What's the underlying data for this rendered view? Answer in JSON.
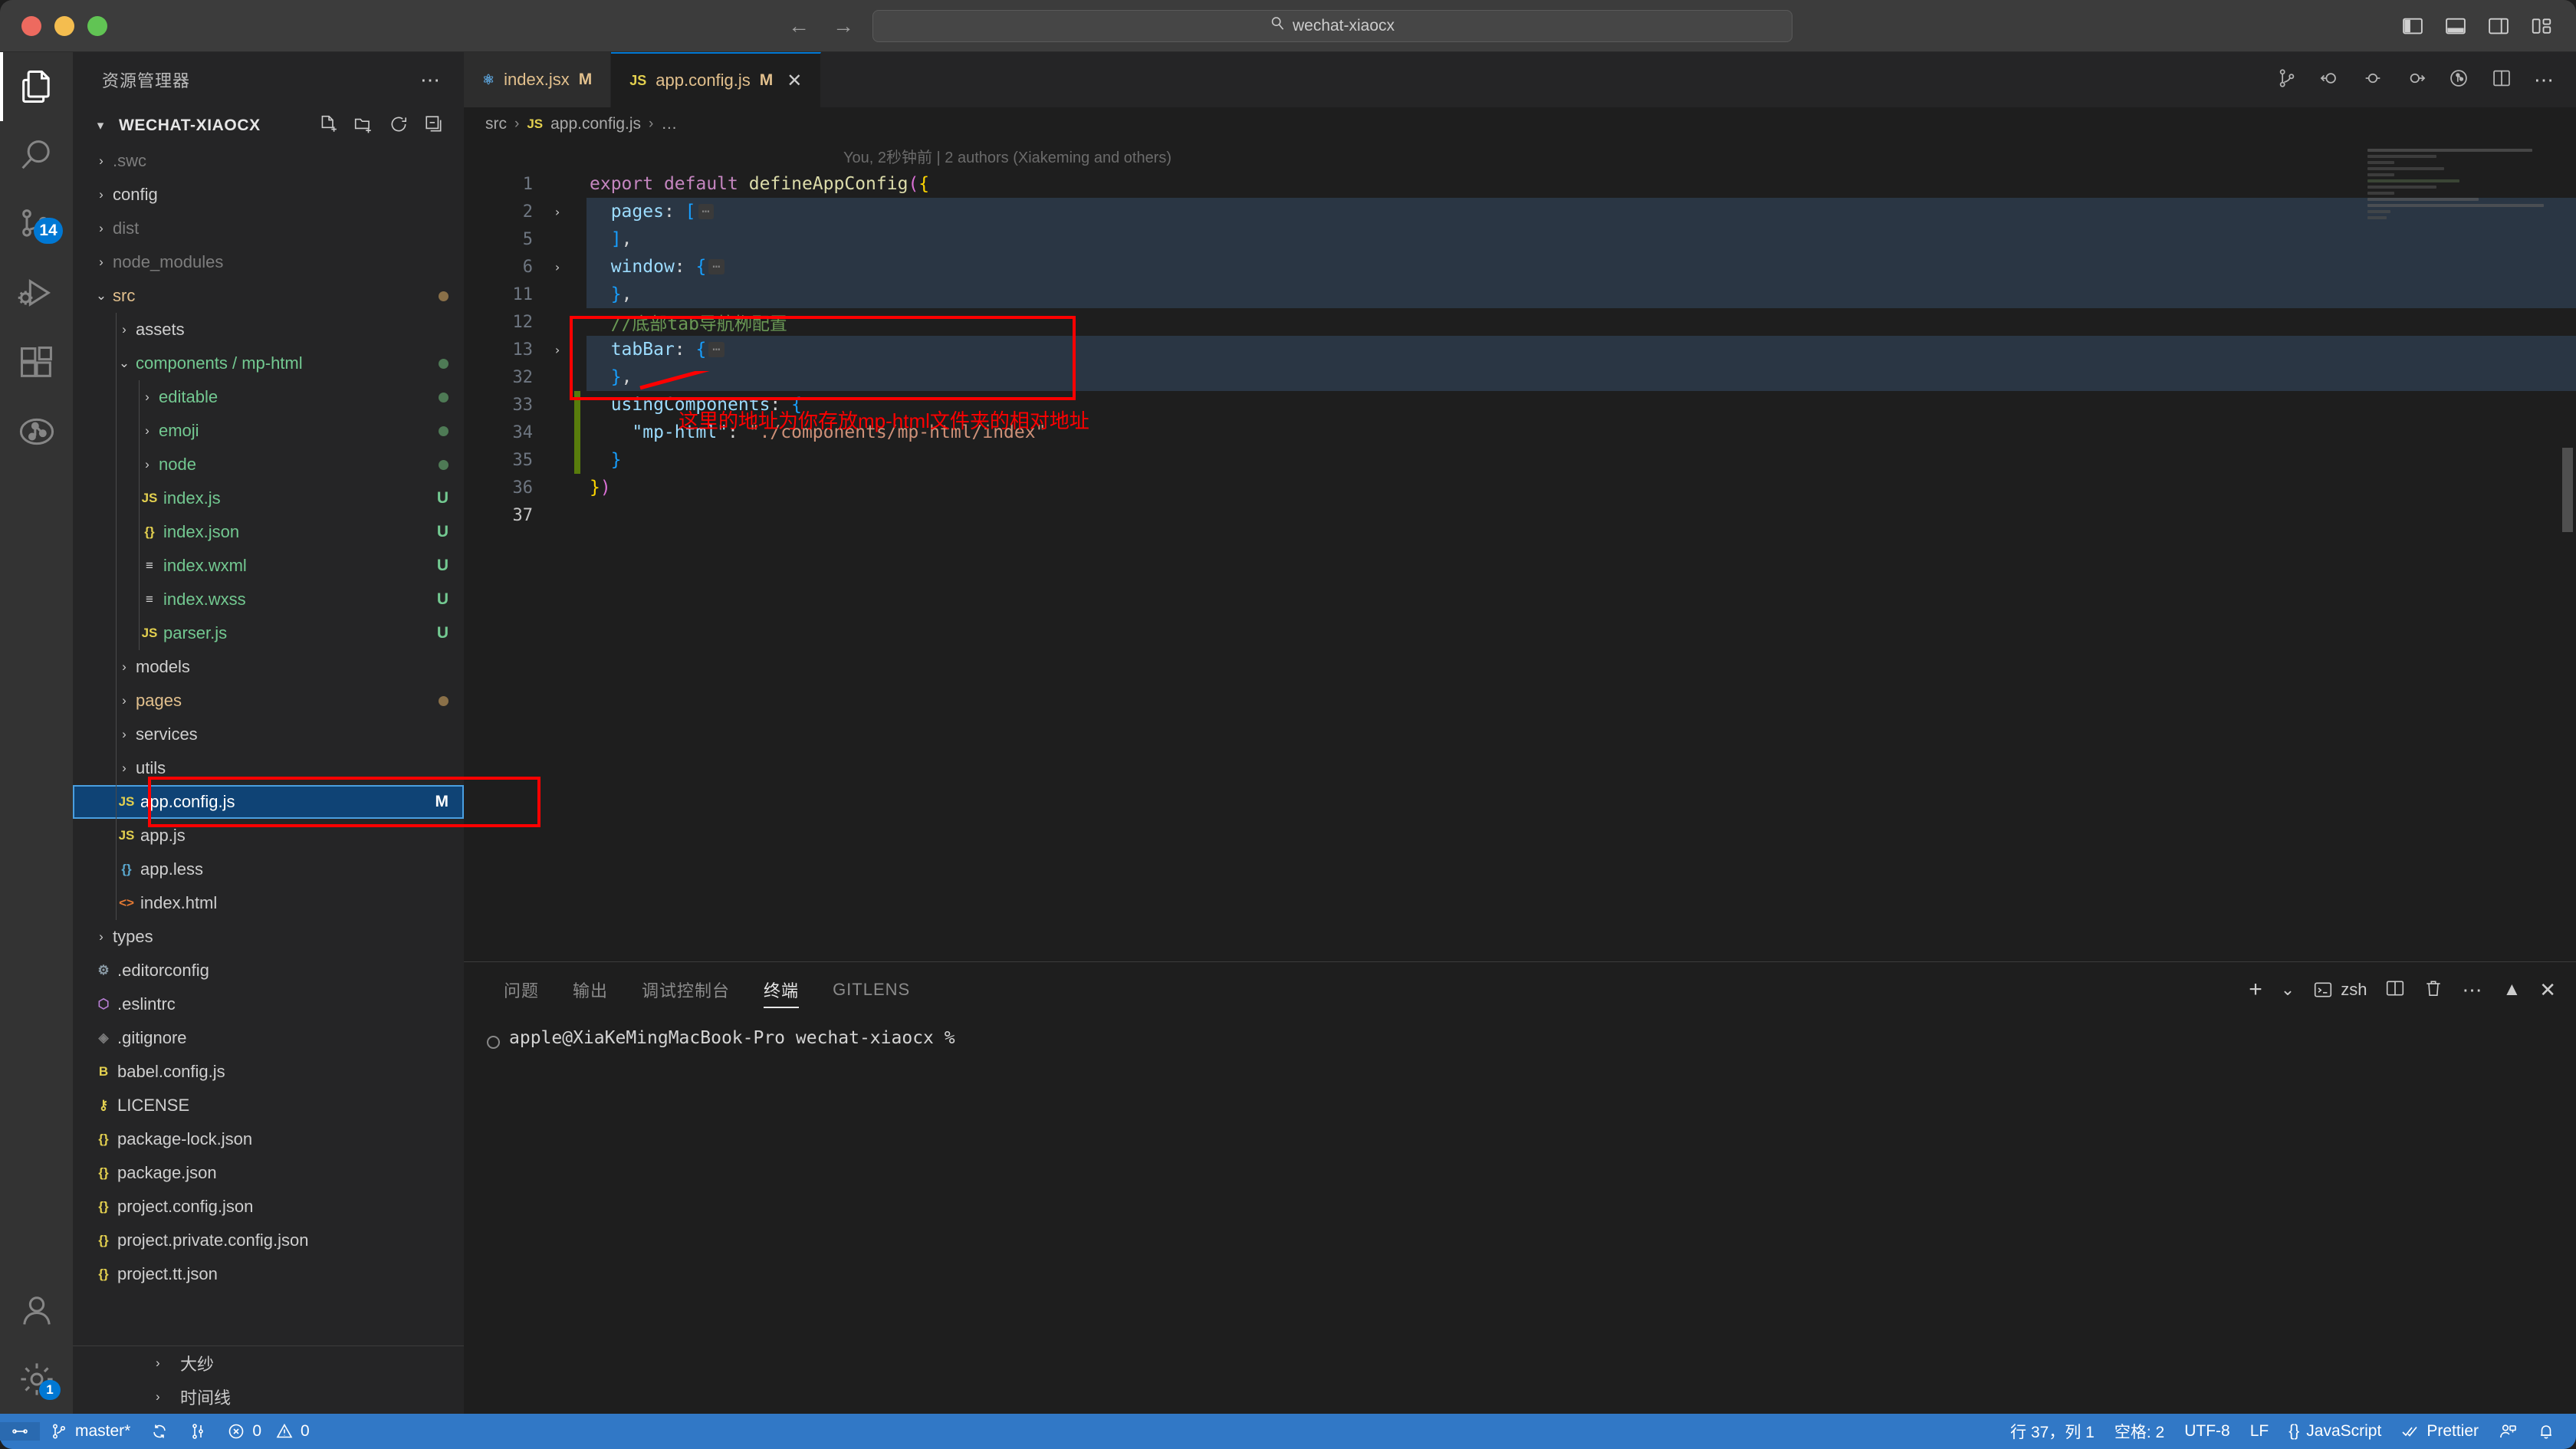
{
  "titlebar": {
    "traffic_lights": [
      "close",
      "minimize",
      "maximize"
    ],
    "back_label": "←",
    "forward_label": "→",
    "command_center": {
      "icon": "search-icon",
      "text": "wechat-xiaocx"
    },
    "layout_icons": [
      "toggle-primary-sidebar-icon",
      "toggle-panel-icon",
      "toggle-secondary-sidebar-icon",
      "customize-layout-icon"
    ]
  },
  "activitybar": {
    "items": [
      {
        "name": "explorer",
        "icon": "files-icon",
        "active": true,
        "badge": ""
      },
      {
        "name": "search",
        "icon": "search-icon",
        "active": false,
        "badge": ""
      },
      {
        "name": "source-control",
        "icon": "source-control-icon",
        "active": false,
        "badge": "14"
      },
      {
        "name": "run-and-debug",
        "icon": "debug-icon",
        "active": false,
        "badge": ""
      },
      {
        "name": "extensions",
        "icon": "extensions-icon",
        "active": false,
        "badge": ""
      },
      {
        "name": "gitlens",
        "icon": "gitlens-icon",
        "active": false,
        "badge": ""
      }
    ],
    "bottom_items": [
      {
        "name": "accounts",
        "icon": "account-icon",
        "badge": ""
      },
      {
        "name": "manage",
        "icon": "gear-icon",
        "badge": "1"
      }
    ]
  },
  "sidebar": {
    "title": "资源管理器",
    "more_label": "⋯",
    "section": {
      "name": "WECHAT-XIAOCX",
      "expanded": true,
      "actions": [
        "new-file-icon",
        "new-folder-icon",
        "refresh-icon",
        "collapse-all-icon"
      ]
    },
    "tree": [
      {
        "label": ".swc",
        "depth": 1,
        "kind": "folder",
        "expanded": false,
        "color": "dim",
        "icon": "",
        "badge": ""
      },
      {
        "label": "config",
        "depth": 1,
        "kind": "folder",
        "expanded": false,
        "color": "default",
        "icon": "",
        "badge": ""
      },
      {
        "label": "dist",
        "depth": 1,
        "kind": "folder",
        "expanded": false,
        "color": "dim",
        "icon": "",
        "badge": ""
      },
      {
        "label": "node_modules",
        "depth": 1,
        "kind": "folder",
        "expanded": false,
        "color": "dim",
        "icon": "",
        "badge": ""
      },
      {
        "label": "src",
        "depth": 1,
        "kind": "folder",
        "expanded": true,
        "color": "mod",
        "icon": "",
        "badge": "dot-mod"
      },
      {
        "label": "assets",
        "depth": 2,
        "kind": "folder",
        "expanded": false,
        "color": "default",
        "icon": "",
        "badge": ""
      },
      {
        "label": "components / mp-html",
        "depth": 2,
        "kind": "folder",
        "expanded": true,
        "color": "untrk",
        "icon": "",
        "badge": "dot-untrk"
      },
      {
        "label": "editable",
        "depth": 3,
        "kind": "folder",
        "expanded": false,
        "color": "untrk",
        "icon": "",
        "badge": "dot-untrk"
      },
      {
        "label": "emoji",
        "depth": 3,
        "kind": "folder",
        "expanded": false,
        "color": "untrk",
        "icon": "",
        "badge": "dot-untrk"
      },
      {
        "label": "node",
        "depth": 3,
        "kind": "folder",
        "expanded": false,
        "color": "untrk",
        "icon": "",
        "badge": "dot-untrk"
      },
      {
        "label": "index.js",
        "depth": 3,
        "kind": "file",
        "expanded": false,
        "color": "untrk",
        "icon": "js",
        "badge": "U"
      },
      {
        "label": "index.json",
        "depth": 3,
        "kind": "file",
        "expanded": false,
        "color": "untrk",
        "icon": "json",
        "badge": "U"
      },
      {
        "label": "index.wxml",
        "depth": 3,
        "kind": "file",
        "expanded": false,
        "color": "untrk",
        "icon": "wxml",
        "badge": "U"
      },
      {
        "label": "index.wxss",
        "depth": 3,
        "kind": "file",
        "expanded": false,
        "color": "untrk",
        "icon": "wxml",
        "badge": "U"
      },
      {
        "label": "parser.js",
        "depth": 3,
        "kind": "file",
        "expanded": false,
        "color": "untrk",
        "icon": "js",
        "badge": "U"
      },
      {
        "label": "models",
        "depth": 2,
        "kind": "folder",
        "expanded": false,
        "color": "default",
        "icon": "",
        "badge": ""
      },
      {
        "label": "pages",
        "depth": 2,
        "kind": "folder",
        "expanded": false,
        "color": "mod",
        "icon": "",
        "badge": "dot-mod"
      },
      {
        "label": "services",
        "depth": 2,
        "kind": "folder",
        "expanded": false,
        "color": "default",
        "icon": "",
        "badge": ""
      },
      {
        "label": "utils",
        "depth": 2,
        "kind": "folder",
        "expanded": false,
        "color": "default",
        "icon": "",
        "badge": ""
      },
      {
        "label": "app.config.js",
        "depth": 2,
        "kind": "file",
        "expanded": false,
        "color": "default",
        "icon": "js",
        "badge": "M",
        "selected": true
      },
      {
        "label": "app.js",
        "depth": 2,
        "kind": "file",
        "expanded": false,
        "color": "default",
        "icon": "js",
        "badge": ""
      },
      {
        "label": "app.less",
        "depth": 2,
        "kind": "file",
        "expanded": false,
        "color": "default",
        "icon": "less",
        "badge": ""
      },
      {
        "label": "index.html",
        "depth": 2,
        "kind": "file",
        "expanded": false,
        "color": "default",
        "icon": "html",
        "badge": ""
      },
      {
        "label": "types",
        "depth": 1,
        "kind": "folder",
        "expanded": false,
        "color": "default",
        "icon": "",
        "badge": ""
      },
      {
        "label": ".editorconfig",
        "depth": 1,
        "kind": "file",
        "expanded": false,
        "color": "default",
        "icon": "gear",
        "badge": ""
      },
      {
        "label": ".eslintrc",
        "depth": 1,
        "kind": "file",
        "expanded": false,
        "color": "default",
        "icon": "eslint",
        "badge": ""
      },
      {
        "label": ".gitignore",
        "depth": 1,
        "kind": "file",
        "expanded": false,
        "color": "default",
        "icon": "git",
        "badge": ""
      },
      {
        "label": "babel.config.js",
        "depth": 1,
        "kind": "file",
        "expanded": false,
        "color": "default",
        "icon": "babel",
        "badge": ""
      },
      {
        "label": "LICENSE",
        "depth": 1,
        "kind": "file",
        "expanded": false,
        "color": "default",
        "icon": "license",
        "badge": ""
      },
      {
        "label": "package-lock.json",
        "depth": 1,
        "kind": "file",
        "expanded": false,
        "color": "default",
        "icon": "json",
        "badge": ""
      },
      {
        "label": "package.json",
        "depth": 1,
        "kind": "file",
        "expanded": false,
        "color": "default",
        "icon": "json",
        "badge": ""
      },
      {
        "label": "project.config.json",
        "depth": 1,
        "kind": "file",
        "expanded": false,
        "color": "default",
        "icon": "json",
        "badge": ""
      },
      {
        "label": "project.private.config.json",
        "depth": 1,
        "kind": "file",
        "expanded": false,
        "color": "default",
        "icon": "json",
        "badge": ""
      },
      {
        "label": "project.tt.json",
        "depth": 1,
        "kind": "file",
        "expanded": false,
        "color": "default",
        "icon": "json",
        "badge": ""
      }
    ],
    "footer_sections": [
      {
        "label": "大纱"
      },
      {
        "label": "时间线"
      }
    ]
  },
  "editor": {
    "tabs": [
      {
        "label": "index.jsx",
        "icon": "react-icon",
        "dirty_badge": "M",
        "active": false,
        "closable": false
      },
      {
        "label": "app.config.js",
        "icon": "js-icon",
        "dirty_badge": "M",
        "active": true,
        "closable": true,
        "close_label": "✕"
      }
    ],
    "tab_actions": [
      "source-control-compare-icon",
      "go-to-previous-change-icon",
      "previous-change-icon",
      "next-change-icon",
      "gitlens-blame-icon",
      "split-editor-icon",
      "more-actions-icon"
    ],
    "breadcrumb": [
      "src",
      "app.config.js",
      "…"
    ],
    "breadcrumb_file_icon": "js-icon",
    "blame": "You, 2秒钟前 | 2 authors (Xiakeming and others)",
    "code_lines": [
      {
        "num": "1",
        "fold": "",
        "git": "",
        "indent_hl": false,
        "tokens": [
          {
            "t": "export ",
            "c": "t-kw"
          },
          {
            "t": "default ",
            "c": "t-kw"
          },
          {
            "t": "defineAppConfig",
            "c": "t-fn"
          },
          {
            "t": "(",
            "c": "t-br2"
          },
          {
            "t": "{",
            "c": "t-br1"
          }
        ]
      },
      {
        "num": "2",
        "fold": "›",
        "git": "",
        "indent_hl": true,
        "tokens": [
          {
            "t": "  ",
            "c": "t-pl"
          },
          {
            "t": "pages",
            "c": "t-prop"
          },
          {
            "t": ": ",
            "c": "t-pl"
          },
          {
            "t": "[",
            "c": "t-br3"
          },
          {
            "t": "FOLD",
            "c": "fold"
          }
        ]
      },
      {
        "num": "5",
        "fold": "",
        "git": "",
        "indent_hl": true,
        "tokens": [
          {
            "t": "  ",
            "c": "t-pl"
          },
          {
            "t": "]",
            "c": "t-br3"
          },
          {
            "t": ",",
            "c": "t-pl"
          }
        ]
      },
      {
        "num": "6",
        "fold": "›",
        "git": "",
        "indent_hl": true,
        "tokens": [
          {
            "t": "  ",
            "c": "t-pl"
          },
          {
            "t": "window",
            "c": "t-prop"
          },
          {
            "t": ": ",
            "c": "t-pl"
          },
          {
            "t": "{",
            "c": "t-br3"
          },
          {
            "t": "FOLD",
            "c": "fold"
          }
        ]
      },
      {
        "num": "11",
        "fold": "",
        "git": "",
        "indent_hl": true,
        "tokens": [
          {
            "t": "  ",
            "c": "t-pl"
          },
          {
            "t": "}",
            "c": "t-br3"
          },
          {
            "t": ",",
            "c": "t-pl"
          }
        ]
      },
      {
        "num": "12",
        "fold": "",
        "git": "",
        "indent_hl": false,
        "tokens": [
          {
            "t": "  //底部tab导航栁配置",
            "c": "t-cmt"
          }
        ]
      },
      {
        "num": "13",
        "fold": "›",
        "git": "",
        "indent_hl": true,
        "tokens": [
          {
            "t": "  ",
            "c": "t-pl"
          },
          {
            "t": "tabBar",
            "c": "t-prop"
          },
          {
            "t": ": ",
            "c": "t-pl"
          },
          {
            "t": "{",
            "c": "t-br3"
          },
          {
            "t": "FOLD",
            "c": "fold"
          }
        ]
      },
      {
        "num": "32",
        "fold": "",
        "git": "",
        "indent_hl": true,
        "tokens": [
          {
            "t": "  ",
            "c": "t-pl"
          },
          {
            "t": "}",
            "c": "t-br3"
          },
          {
            "t": ",",
            "c": "t-pl"
          }
        ]
      },
      {
        "num": "33",
        "fold": "",
        "git": "added",
        "indent_hl": false,
        "tokens": [
          {
            "t": "  ",
            "c": "t-pl"
          },
          {
            "t": "usingComponents",
            "c": "t-prop"
          },
          {
            "t": ": ",
            "c": "t-pl"
          },
          {
            "t": "{",
            "c": "t-br3"
          }
        ]
      },
      {
        "num": "34",
        "fold": "",
        "git": "added",
        "indent_hl": false,
        "tokens": [
          {
            "t": "    ",
            "c": "t-pl"
          },
          {
            "t": "\"mp-html\"",
            "c": "t-prop"
          },
          {
            "t": ": ",
            "c": "t-pl"
          },
          {
            "t": "\"./components/mp-html/index\"",
            "c": "t-str"
          }
        ]
      },
      {
        "num": "35",
        "fold": "",
        "git": "added",
        "indent_hl": false,
        "tokens": [
          {
            "t": "  ",
            "c": "t-pl"
          },
          {
            "t": "}",
            "c": "t-br3"
          }
        ]
      },
      {
        "num": "36",
        "fold": "",
        "git": "",
        "indent_hl": false,
        "tokens": [
          {
            "t": "}",
            "c": "t-br1"
          },
          {
            "t": ")",
            "c": "t-br2"
          }
        ]
      },
      {
        "num": "37",
        "fold": "",
        "git": "",
        "indent_hl": false,
        "current": true,
        "tokens": []
      }
    ],
    "annotations": {
      "code_box_label": "highlight-using-components",
      "tree_box_label": "highlight-app-config-file",
      "note_text": "这里的地址为你存放mp-html文件夹的相对地址",
      "arrow_label": "arrow-pointing-from-code-to-file",
      "color": "#ff0000"
    }
  },
  "panel": {
    "tabs": [
      {
        "label": "问题",
        "active": false
      },
      {
        "label": "输出",
        "active": false
      },
      {
        "label": "调试控制台",
        "active": false
      },
      {
        "label": "终端",
        "active": true
      },
      {
        "label": "GITLENS",
        "active": false
      }
    ],
    "actions": {
      "new_terminal": "+",
      "split_dropdown": "⌄",
      "shell_icon": "terminal-icon",
      "shell_name": "zsh",
      "split_terminal": "split-terminal-icon",
      "kill_terminal": "trash-icon",
      "more": "⋯",
      "maximize": "chevron-up-icon",
      "close": "✕"
    },
    "terminal_lines": [
      "apple@XiaKeMingMacBook-Pro wechat-xiaocx %"
    ]
  },
  "statusbar": {
    "left": [
      {
        "name": "remote-indicator",
        "icon": "remote-icon",
        "label": ""
      },
      {
        "name": "branch",
        "icon": "branch-icon",
        "label": "master*"
      },
      {
        "name": "sync-changes",
        "icon": "sync-icon",
        "label": ""
      },
      {
        "name": "gitlens-graph",
        "icon": "graph-icon",
        "label": ""
      },
      {
        "name": "problems",
        "icon": "error-icon",
        "label": "0"
      },
      {
        "name": "warnings",
        "icon": "warning-icon",
        "label": "0"
      }
    ],
    "right": [
      {
        "name": "cursor-position",
        "label": "行 37，列 1"
      },
      {
        "name": "indentation",
        "label": "空格: 2"
      },
      {
        "name": "encoding",
        "label": "UTF-8"
      },
      {
        "name": "eol",
        "label": "LF"
      },
      {
        "name": "language-mode",
        "label": "JavaScript",
        "icon": "json-brace-icon"
      },
      {
        "name": "prettier",
        "label": "Prettier",
        "icon": "check-check-icon"
      },
      {
        "name": "live-share",
        "label": "",
        "icon": "live-share-icon"
      },
      {
        "name": "notifications",
        "label": "",
        "icon": "bell-icon"
      }
    ],
    "accent_color": "#3178c6"
  }
}
